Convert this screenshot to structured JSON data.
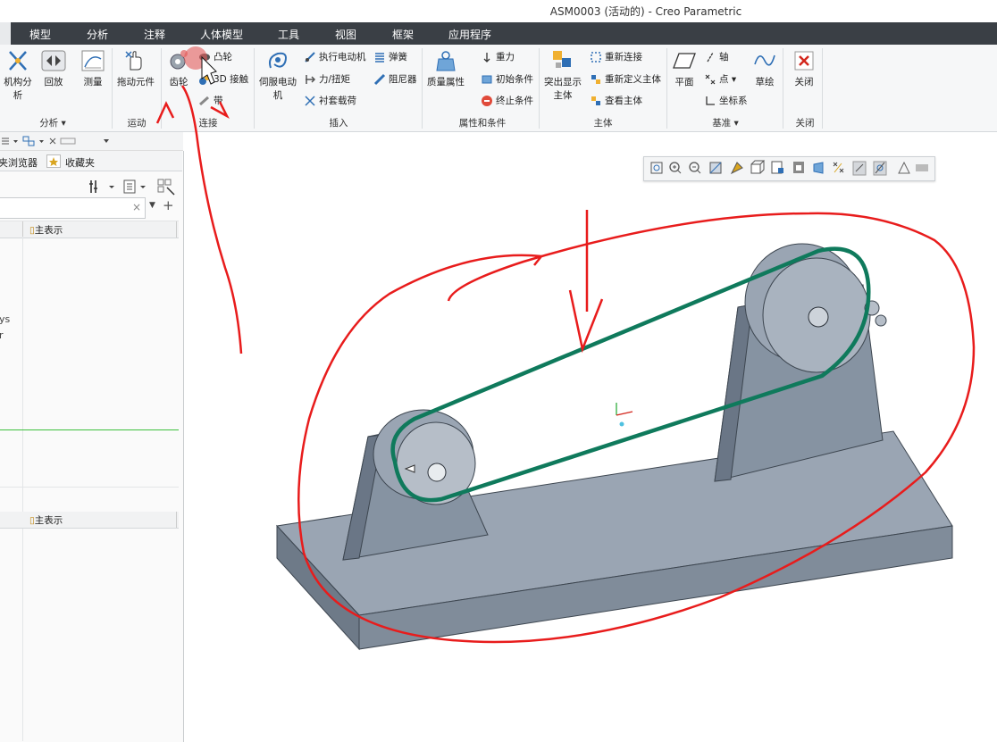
{
  "window": {
    "title": "ASM0003 (活动的) - Creo Parametric"
  },
  "menu": {
    "tabs": [
      "模型",
      "分析",
      "注释",
      "人体模型",
      "工具",
      "视图",
      "框架",
      "应用程序"
    ]
  },
  "ribbon": {
    "analysis": {
      "mech_analysis": "机构分析",
      "playback": "回放",
      "measure": "测量",
      "group": "分析"
    },
    "motion": {
      "drag": "拖动元件",
      "group": "运动"
    },
    "connect": {
      "gear": "齿轮",
      "cam": "凸轮",
      "contact3d": "3D 接触",
      "belt": "带",
      "group": "连接"
    },
    "insert": {
      "servo": "伺服电动机",
      "actuator": "执行电动机",
      "spring": "弹簧",
      "force": "力/扭矩",
      "damper": "阻尼器",
      "bushing": "衬套载荷",
      "group": "插入"
    },
    "props": {
      "mass": "质量属性",
      "gravity": "重力",
      "initial": "初始条件",
      "end": "终止条件",
      "group": "属性和条件"
    },
    "body": {
      "highlight": "突出显示主体",
      "reconnect": "重新连接",
      "redefine": "重新定义主体",
      "view": "查看主体",
      "group": "主体"
    },
    "datum": {
      "plane": "平面",
      "axis": "轴",
      "point": "点",
      "csys": "坐标系",
      "sketch": "草绘",
      "group": "基准"
    },
    "close": {
      "close": "关闭",
      "group": "关闭"
    }
  },
  "left_panel": {
    "tabs": {
      "browser": "夹浏览器",
      "favorites": "收藏夹"
    },
    "col_header_1": "主表示",
    "col_header_2": "主表示",
    "partial_text_1": "ys",
    "partial_text_2": "r"
  },
  "colors": {
    "menubar": "#3a3f45",
    "model": "#8d98a6",
    "belt": "#0f7a5c",
    "annotation": "#e81c1c"
  }
}
